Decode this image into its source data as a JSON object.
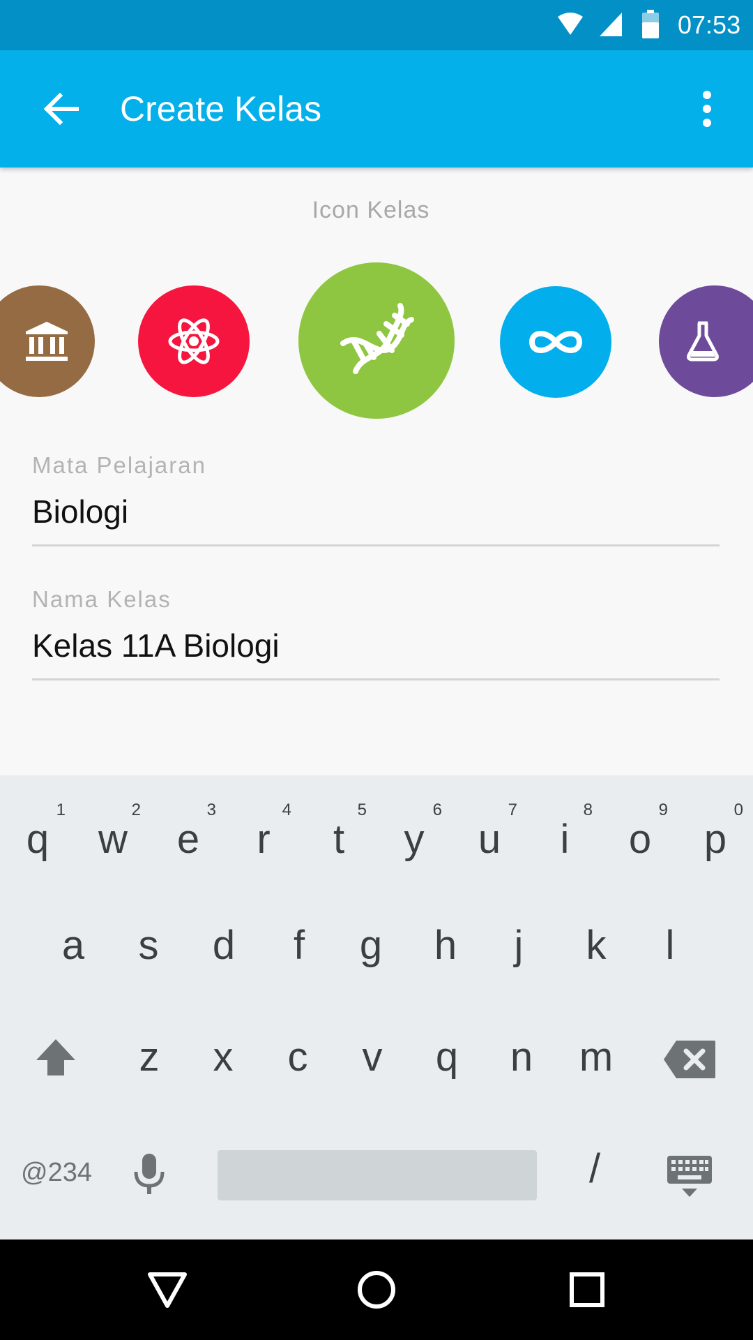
{
  "status_bar": {
    "time": "07:53"
  },
  "app_bar": {
    "title": "Create Kelas"
  },
  "icon_picker": {
    "caption": "Icon Kelas",
    "icons": [
      {
        "name": "museum-icon",
        "color": "#956b43",
        "selected": false
      },
      {
        "name": "atom-icon",
        "color": "#f5153f",
        "selected": false
      },
      {
        "name": "dna-icon",
        "color": "#8fc641",
        "selected": true
      },
      {
        "name": "infinity-icon",
        "color": "#03aeec",
        "selected": false
      },
      {
        "name": "flask-icon",
        "color": "#6e4a9a",
        "selected": false
      }
    ]
  },
  "form": {
    "subject": {
      "label": "Mata Pelajaran",
      "value": "Biologi"
    },
    "class_name": {
      "label": "Nama Kelas",
      "value": "Kelas 11A Biologi"
    }
  },
  "keyboard": {
    "row1": [
      {
        "key": "q",
        "hint": "1"
      },
      {
        "key": "w",
        "hint": "2"
      },
      {
        "key": "e",
        "hint": "3"
      },
      {
        "key": "r",
        "hint": "4"
      },
      {
        "key": "t",
        "hint": "5"
      },
      {
        "key": "y",
        "hint": "6"
      },
      {
        "key": "u",
        "hint": "7"
      },
      {
        "key": "i",
        "hint": "8"
      },
      {
        "key": "o",
        "hint": "9"
      },
      {
        "key": "p",
        "hint": "0"
      }
    ],
    "row2": [
      "a",
      "s",
      "d",
      "f",
      "g",
      "h",
      "j",
      "k",
      "l"
    ],
    "row3": [
      "z",
      "x",
      "c",
      "v",
      "q",
      "n",
      "m"
    ],
    "symbols_label": "@234",
    "slash_label": "/"
  },
  "colors": {
    "status_bar": "#0290c7",
    "app_bar": "#03b0ea",
    "accent": "#03b0ea"
  }
}
